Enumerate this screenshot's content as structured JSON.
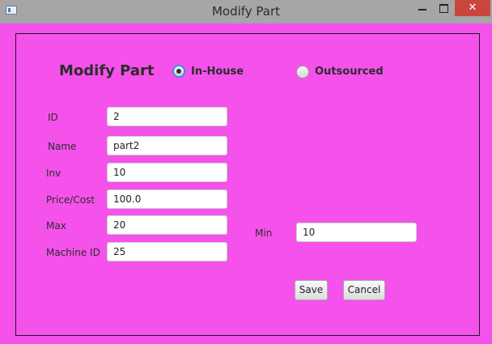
{
  "window": {
    "title": "Modify Part",
    "close_glyph": "✕"
  },
  "form": {
    "heading": "Modify Part",
    "source_options": [
      {
        "label": "In-House",
        "selected": true
      },
      {
        "label": "Outsourced",
        "selected": false
      }
    ],
    "fields": {
      "id": {
        "label": "ID",
        "value": "2"
      },
      "name": {
        "label": "Name",
        "value": "part2"
      },
      "inv": {
        "label": "Inv",
        "value": "10"
      },
      "price": {
        "label": "Price/Cost",
        "value": "100.0"
      },
      "max": {
        "label": "Max",
        "value": "20"
      },
      "min": {
        "label": "Min",
        "value": "10"
      },
      "machine_id": {
        "label": "Machine ID",
        "value": "25"
      }
    },
    "buttons": {
      "save": "Save",
      "cancel": "Cancel"
    }
  },
  "colors": {
    "background": "#f452ea",
    "titlebar": "#a6a6a6",
    "close": "#c9463d",
    "radio_focus": "#3a8be0"
  },
  "icons": {
    "app": "app-window-icon",
    "minimize": "minimize-icon",
    "maximize": "maximize-icon",
    "close": "close-icon"
  }
}
